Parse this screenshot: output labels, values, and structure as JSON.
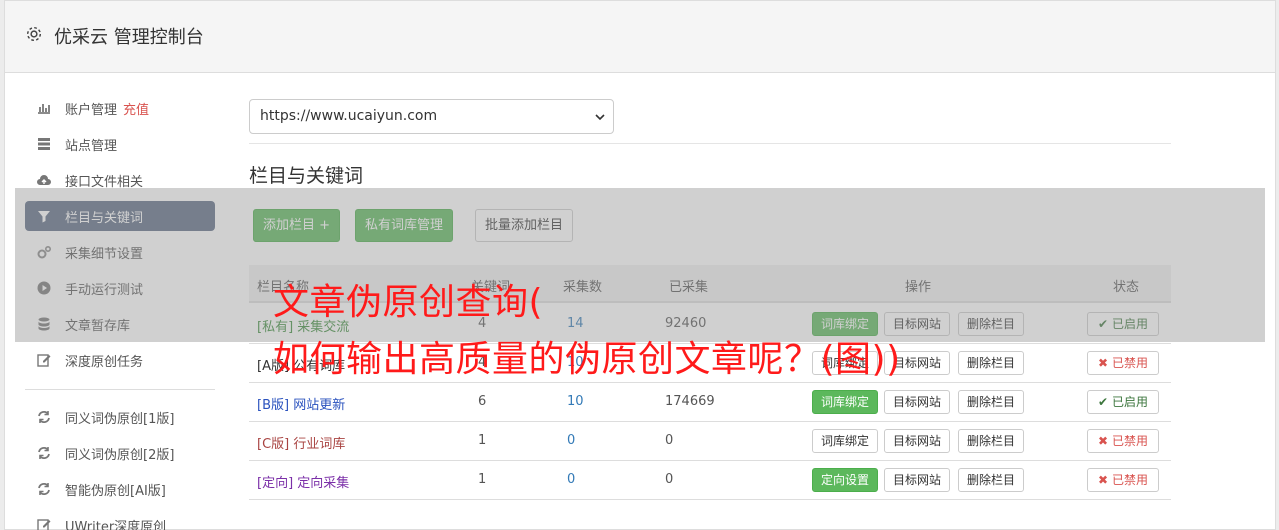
{
  "header": {
    "title": "优采云 管理控制台",
    "icon": "gear-icon"
  },
  "sidebar": {
    "items": [
      {
        "label": "账户管理",
        "extra": "充值",
        "icon": "bar-chart-icon"
      },
      {
        "label": "站点管理",
        "icon": "server-icon"
      },
      {
        "label": "接口文件相关",
        "icon": "cloud-upload-icon"
      },
      {
        "label": "栏目与关键词",
        "icon": "filter-icon",
        "active": true
      },
      {
        "label": "采集细节设置",
        "icon": "cogs-icon"
      },
      {
        "label": "手动运行测试",
        "icon": "play-circle-icon"
      },
      {
        "label": "文章暂存库",
        "icon": "database-icon"
      },
      {
        "label": "深度原创任务",
        "icon": "edit-icon"
      }
    ],
    "items2": [
      {
        "label": "同义词伪原创[1版]",
        "icon": "refresh-icon"
      },
      {
        "label": "同义词伪原创[2版]",
        "icon": "refresh-icon"
      },
      {
        "label": "智能伪原创[AI版]",
        "icon": "refresh-icon"
      },
      {
        "label": "UWriter深度原创",
        "icon": "edit-icon"
      }
    ]
  },
  "main": {
    "site_select": "https://www.ucaiyun.com",
    "section_title": "栏目与关键词",
    "buttons": {
      "add_column": "添加栏目 +",
      "private_lib": "私有词库管理",
      "batch_add": "批量添加栏目"
    },
    "table": {
      "headers": [
        "栏目名称",
        "关键词",
        "采集数",
        "已采集",
        "操作",
        "状态"
      ],
      "rows": [
        {
          "name": "[私有] 采集交流",
          "c1": "4",
          "c2": "14",
          "c3": "92460",
          "op": "词库绑定",
          "op_green": true,
          "status": "已启用",
          "on": true,
          "color": "#3c8d3c"
        },
        {
          "name": "[A版] 公有词库",
          "c1": "4",
          "c2": "10",
          "c3": "",
          "op": "词库绑定",
          "op_green": false,
          "status": "已禁用",
          "on": false,
          "color": "#333333"
        },
        {
          "name": "[B版] 网站更新",
          "c1": "6",
          "c2": "10",
          "c3": "174669",
          "op": "词库绑定",
          "op_green": true,
          "status": "已启用",
          "on": true,
          "color": "#2a52be"
        },
        {
          "name": "[C版] 行业词库",
          "c1": "1",
          "c2": "0",
          "c3": "0",
          "op": "词库绑定",
          "op_green": false,
          "status": "已禁用",
          "on": false,
          "color": "#a94442"
        },
        {
          "name": "[定向] 定向采集",
          "c1": "1",
          "c2": "0",
          "c3": "0",
          "op": "定向设置",
          "op_green": true,
          "status": "已禁用",
          "on": false,
          "color": "#7b2fa8"
        }
      ],
      "target_label": "目标网站",
      "delete_label": "删除栏目"
    }
  },
  "watermark": {
    "line1": "文章伪原创查询(",
    "line2": "如何输出高质量的伪原创文章呢？(图))"
  }
}
